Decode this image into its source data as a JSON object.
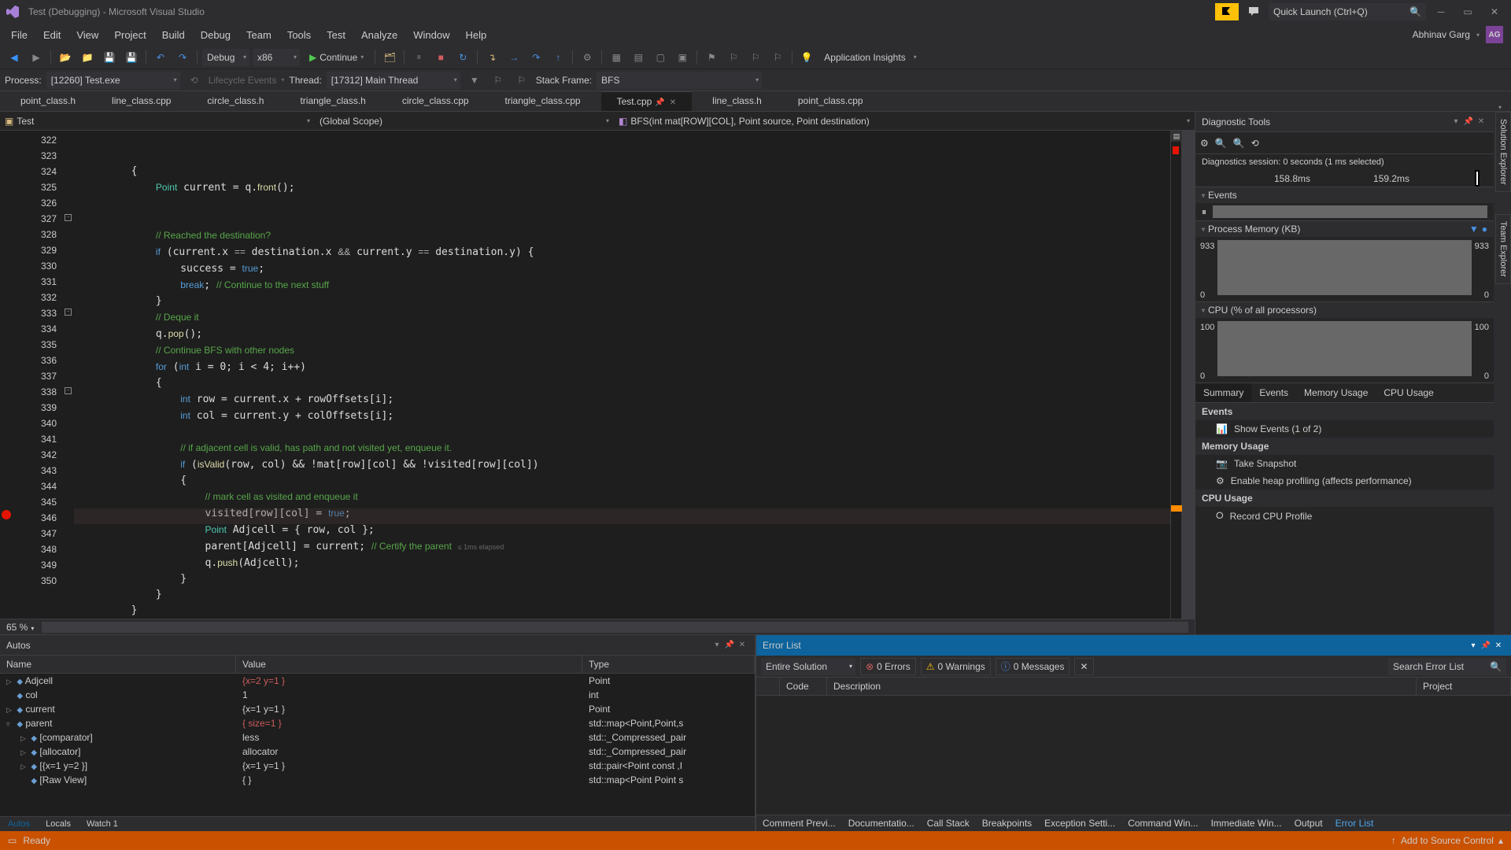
{
  "title": "Test (Debugging) - Microsoft Visual Studio",
  "quicklaunch_placeholder": "Quick Launch (Ctrl+Q)",
  "menu": [
    "File",
    "Edit",
    "View",
    "Project",
    "Build",
    "Debug",
    "Team",
    "Tools",
    "Test",
    "Analyze",
    "Window",
    "Help"
  ],
  "user_name": "Abhinav Garg",
  "user_initials": "AG",
  "toolbar": {
    "config": "Debug",
    "platform": "x86",
    "continue": "Continue",
    "insights": "Application Insights"
  },
  "toolbar2": {
    "process_label": "Process:",
    "process": "[12260] Test.exe",
    "lifecycle": "Lifecycle Events",
    "thread_label": "Thread:",
    "thread": "[17312] Main Thread",
    "stack_label": "Stack Frame:",
    "stack": "BFS"
  },
  "tabs": [
    "point_class.h",
    "line_class.cpp",
    "circle_class.h",
    "triangle_class.h",
    "circle_class.cpp",
    "triangle_class.cpp",
    "Test.cpp",
    "line_class.h",
    "point_class.cpp"
  ],
  "active_tab": "Test.cpp",
  "navbar": {
    "left": "Test",
    "mid": "(Global Scope)",
    "right": "BFS(int mat[ROW][COL], Point source, Point destination)"
  },
  "line_start": 322,
  "line_count": 29,
  "zoom": "65 %",
  "diagnostic": {
    "title": "Diagnostic Tools",
    "session": "Diagnostics session: 0 seconds (1 ms selected)",
    "ruler": [
      "158.8ms",
      "159.2ms"
    ],
    "events_hdr": "Events",
    "pause": "⏸",
    "mem_hdr": "Process Memory (KB)",
    "mem_left": "933",
    "mem_right": "933",
    "mem_bl": "0",
    "mem_br": "0",
    "cpu_hdr": "CPU (% of all processors)",
    "cpu_left": "100",
    "cpu_right": "100",
    "cpu_bl": "0",
    "cpu_br": "0",
    "tabs": [
      "Summary",
      "Events",
      "Memory Usage",
      "CPU Usage"
    ],
    "events_group": "Events",
    "show_events": "Show Events (1 of 2)",
    "mem_group": "Memory Usage",
    "snapshot": "Take Snapshot",
    "heap": "Enable heap profiling (affects performance)",
    "cpu_group": "CPU Usage",
    "record": "Record CPU Profile"
  },
  "autos": {
    "title": "Autos",
    "cols": [
      "Name",
      "Value",
      "Type"
    ],
    "rows": [
      {
        "name": "Adjcell",
        "value": "{x=2 y=1 }",
        "type": "Point",
        "red": true,
        "exp": "▷",
        "indent": 0
      },
      {
        "name": "col",
        "value": "1",
        "type": "int",
        "indent": 0
      },
      {
        "name": "current",
        "value": "{x=1 y=1 }",
        "type": "Point",
        "exp": "▷",
        "indent": 0
      },
      {
        "name": "parent",
        "value": "{ size=1 }",
        "type": "std::map<Point,Point,s",
        "red": true,
        "exp": "▿",
        "indent": 0
      },
      {
        "name": "[comparator]",
        "value": "less",
        "type": "std::_Compressed_pair",
        "exp": "▷",
        "indent": 1
      },
      {
        "name": "[allocator]",
        "value": "allocator",
        "type": "std::_Compressed_pair",
        "exp": "▷",
        "indent": 1
      },
      {
        "name": "[{x=1 y=2 }]",
        "value": "{x=1 y=1 }",
        "type": "std::pair<Point const ,I",
        "exp": "▷",
        "indent": 1
      },
      {
        "name": "[Raw View]",
        "value": "{ }",
        "type": "std::map<Point Point s",
        "indent": 1
      }
    ],
    "tabs": [
      "Autos",
      "Locals",
      "Watch 1"
    ]
  },
  "errorlist": {
    "title": "Error List",
    "scope": "Entire Solution",
    "errors": "0 Errors",
    "warnings": "0 Warnings",
    "messages": "0 Messages",
    "search": "Search Error List",
    "cols": [
      "",
      "Code",
      "Description",
      "Project"
    ]
  },
  "output_tabs": [
    "Comment Previ...",
    "Documentatio...",
    "Call Stack",
    "Breakpoints",
    "Exception Setti...",
    "Command Win...",
    "Immediate Win...",
    "Output",
    "Error List"
  ],
  "status": "Ready",
  "source_control": "Add to Source Control",
  "side_tabs": {
    "solution": "Solution Explorer",
    "team": "Team Explorer"
  }
}
